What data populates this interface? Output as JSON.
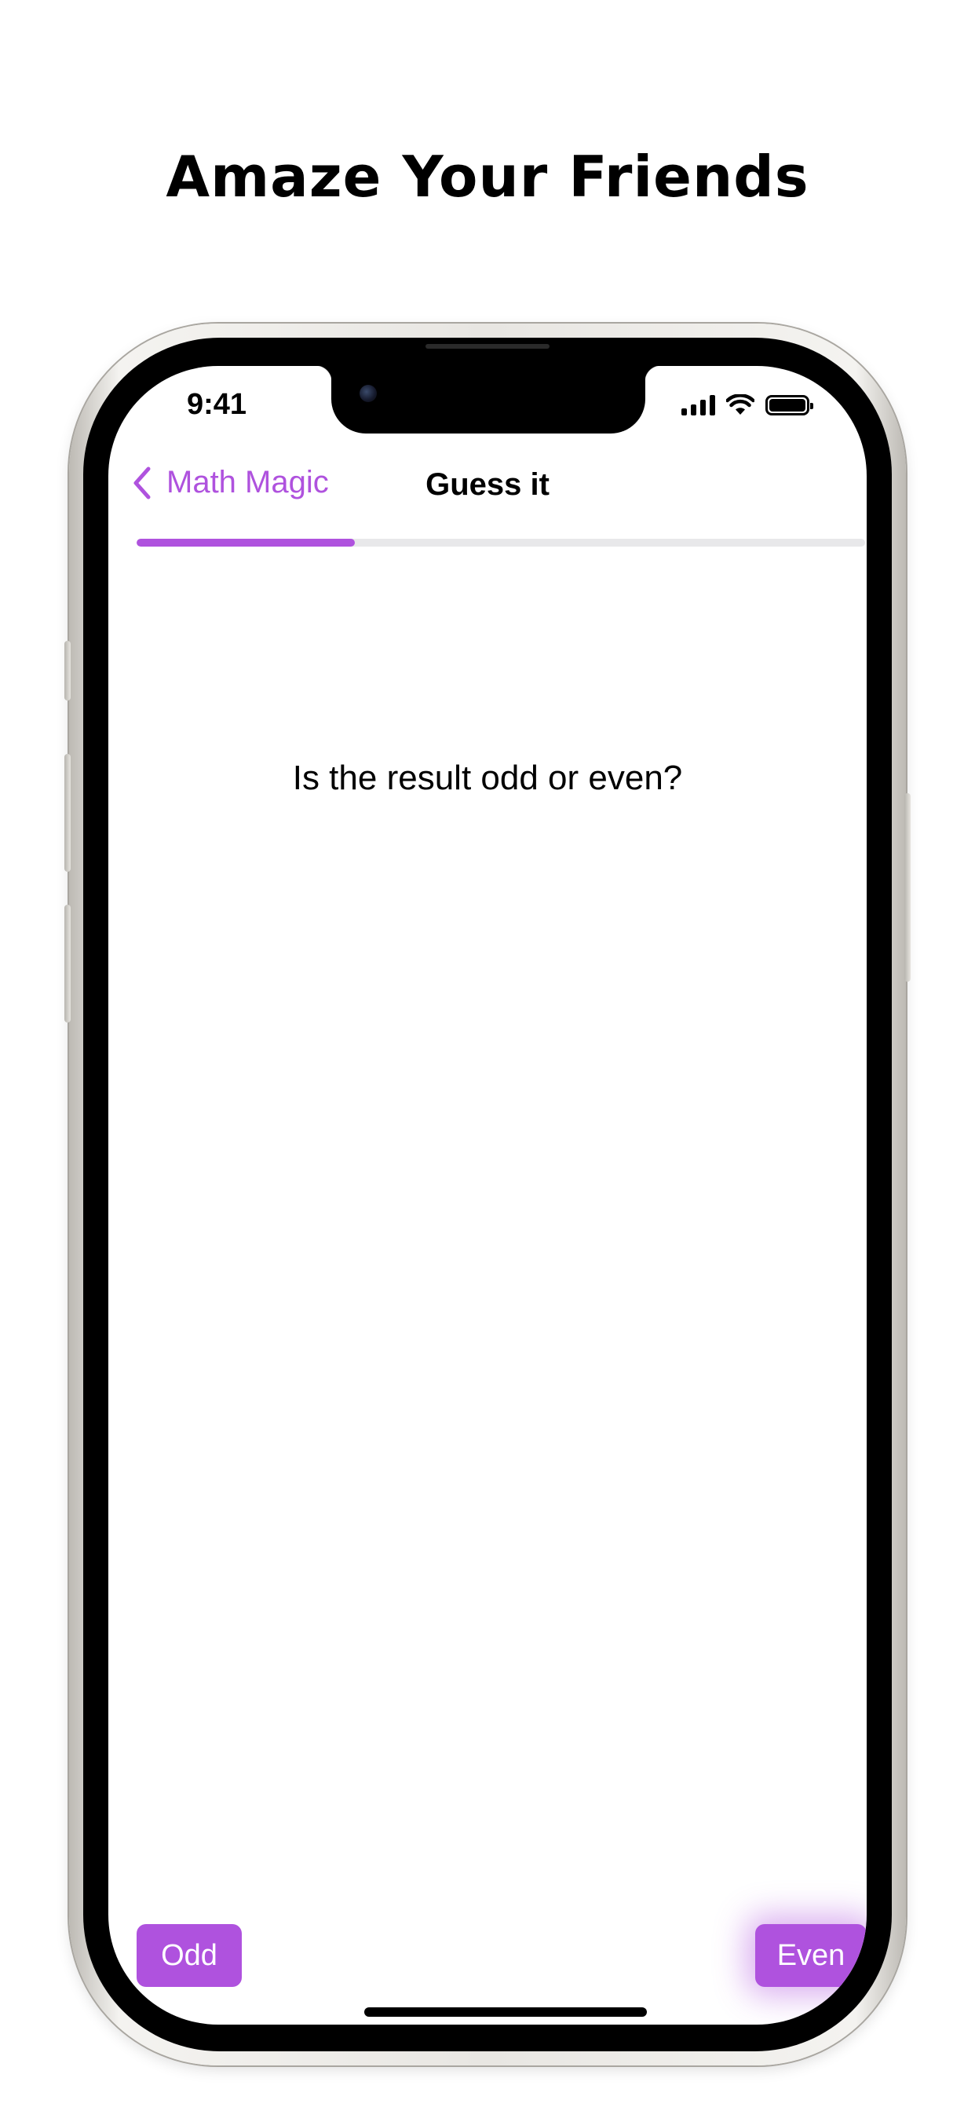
{
  "promo": {
    "headline": "Amaze Your Friends"
  },
  "status_bar": {
    "time": "9:41",
    "icons": [
      "cellular-signal-icon",
      "wifi-icon",
      "battery-icon"
    ]
  },
  "nav": {
    "back_label": "Math Magic",
    "back_icon": "chevron-left-icon",
    "title": "Guess it"
  },
  "progress": {
    "value": 0.3
  },
  "content": {
    "question": "Is the result odd or even?"
  },
  "actions": {
    "odd_label": "Odd",
    "even_label": "Even"
  },
  "colors": {
    "accent": "#AF52DE",
    "progress_track": "#E8E8EA",
    "text": "#000000",
    "background": "#FFFFFF"
  }
}
